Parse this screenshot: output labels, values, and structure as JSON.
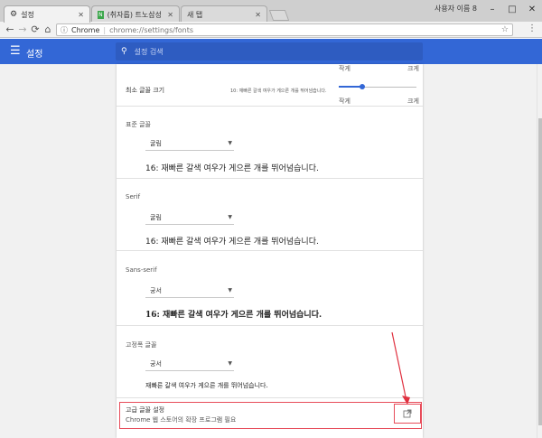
{
  "browser": {
    "tabs": [
      {
        "label": "설정",
        "active": true
      },
      {
        "label": "(취자롭) 트노삼성 대리점",
        "active": false
      },
      {
        "label": "새 탭",
        "active": false
      }
    ],
    "user_label": "사용자 이름 8",
    "omnibox": {
      "secure_label": "Chrome",
      "url": "chrome://settings/fonts"
    }
  },
  "settings": {
    "title": "설정",
    "search_placeholder": "설정 검색"
  },
  "fonts": {
    "top_slider_min": "작게",
    "top_slider_max": "크게",
    "min_font_size_label": "최소 글꼴 크기",
    "min_font_sample": "10: 재빠른 갈색 여우가 게으른 개를 뛰어넘습니다.",
    "min_slider_min": "작게",
    "min_slider_max": "크게",
    "min_slider_fraction": 0.3,
    "standard": {
      "title": "표준 글꼴",
      "font": "굴림",
      "sample": "16: 재빠른 갈색 여우가 게으른 개를 뛰어넘습니다."
    },
    "serif": {
      "title": "Serif",
      "font": "굴림",
      "sample": "16: 재빠른 갈색 여우가 게으른 개를 뛰어넘습니다."
    },
    "sans_serif": {
      "title": "Sans-serif",
      "font": "궁서",
      "sample": "16: 재빠른 갈색 여우가 게으른 개를 뛰어넘습니다."
    },
    "fixed": {
      "title": "고정폭 글꼴",
      "font": "궁서",
      "sample": "재빠른 갈색 여우가 게으른 개를 뛰어넘습니다."
    },
    "advanced": {
      "title": "고급 글꼴 설정",
      "subtitle": "Chrome 웹 스토어의 확장 프로그램 필요"
    }
  },
  "colors": {
    "accent": "#3367d6",
    "highlight": "#e74c5a"
  }
}
